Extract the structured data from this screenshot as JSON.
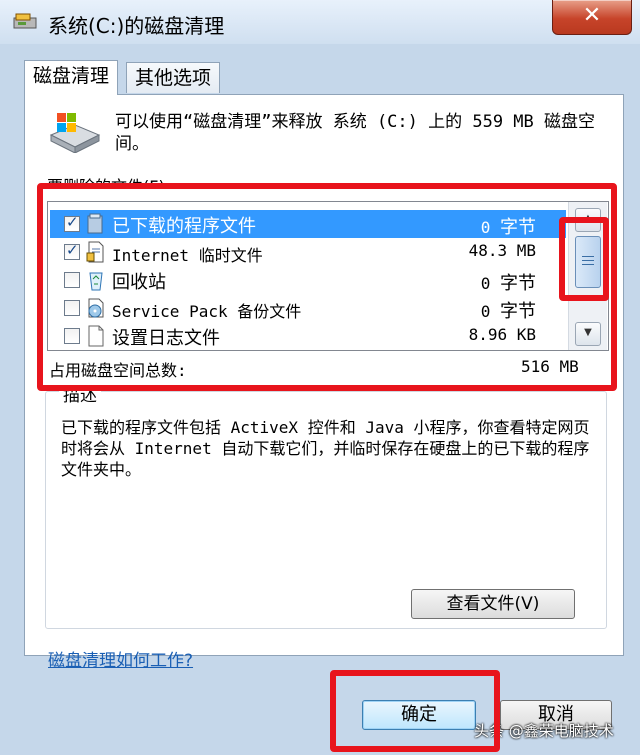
{
  "window": {
    "title": "系统(C:)的磁盘清理",
    "close_label": "✕"
  },
  "tabs": [
    {
      "label": "磁盘清理",
      "active": true
    },
    {
      "label": "其他选项",
      "active": false
    }
  ],
  "intro_text": "可以使用“磁盘清理”来释放 系统 (C:) 上的 559 MB 磁盘空间。",
  "list_label": "要删除的文件(F):",
  "files": [
    {
      "name": "已下载的程序文件",
      "size": "0",
      "unit": "字节",
      "checked": true,
      "selected": true,
      "icon": "folder-icon"
    },
    {
      "name": "Internet 临时文件",
      "size": "48.3 M",
      "unit": "B",
      "checked": true,
      "selected": false,
      "icon": "document-lock-icon"
    },
    {
      "name": "回收站",
      "size": "0",
      "unit": "字节",
      "checked": false,
      "selected": false,
      "icon": "recycle-bin-icon"
    },
    {
      "name": "Service Pack 备份文件",
      "size": "0",
      "unit": "字节",
      "checked": false,
      "selected": false,
      "icon": "backup-disc-icon"
    },
    {
      "name": "设置日志文件",
      "size": "8.96 KB",
      "unit": "",
      "checked": false,
      "selected": false,
      "icon": "blank-file-icon"
    }
  ],
  "total": {
    "label": "占用磁盘空间总数:",
    "value": "516 MB"
  },
  "description": {
    "title": "描述",
    "text": "已下载的程序文件包括 ActiveX 控件和 Java 小程序，你查看特定网页时将会从 Internet 自动下载它们，并临时保存在硬盘上的已下载的程序文件夹中。"
  },
  "view_files_label": "查看文件(V)",
  "help_link": "磁盘清理如何工作?",
  "buttons": {
    "ok": "确定",
    "cancel": "取消"
  },
  "watermark": "头条 @鑫荣电脑技术",
  "colors": {
    "highlight": "#e8141c",
    "selection": "#3399ff"
  }
}
